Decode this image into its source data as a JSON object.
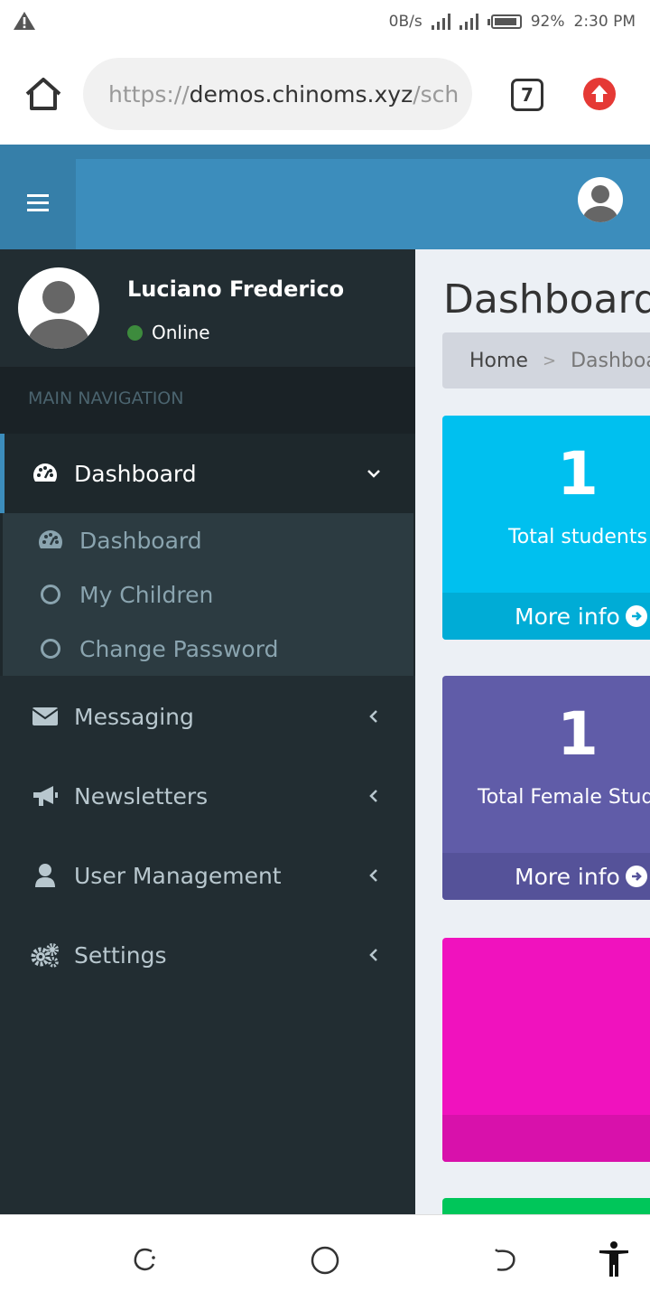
{
  "status_bar": {
    "net_speed": "0B/s",
    "battery": "92%",
    "time": "2:30 PM",
    "battery_level": 0.92
  },
  "browser": {
    "url_scheme": "https://",
    "url_host": "demos.chinoms.xyz",
    "url_path": "/sch",
    "tab_count": "7"
  },
  "user": {
    "name": "Luciano Frederico",
    "status": "Online"
  },
  "sidebar": {
    "nav_header": "MAIN NAVIGATION",
    "items": [
      {
        "label": "Dashboard",
        "icon": "dashboard-icon"
      },
      {
        "label": "Messaging",
        "icon": "envelope-icon"
      },
      {
        "label": "Newsletters",
        "icon": "bullhorn-icon"
      },
      {
        "label": "User Management",
        "icon": "user-icon"
      },
      {
        "label": "Settings",
        "icon": "gears-icon"
      }
    ],
    "submenu": [
      {
        "label": "Dashboard",
        "icon": "dashboard-icon"
      },
      {
        "label": "My Children",
        "icon": "circle-o-icon"
      },
      {
        "label": "Change Password",
        "icon": "circle-o-icon"
      }
    ]
  },
  "content": {
    "title": "Dashboard",
    "breadcrumb": {
      "home": "Home",
      "current": "Dashboard"
    },
    "boxes": [
      {
        "number": "1",
        "label": "Total students",
        "footer": "More info",
        "color": "#00c0ef",
        "footer_color": "#00acd6"
      },
      {
        "number": "1",
        "label": "Total Female Students",
        "footer": "More info",
        "color": "#605ca8",
        "footer_color": "#555299"
      },
      {
        "color": "#f012be",
        "footer_color": "#d811ab"
      },
      {
        "color": "#00c65a"
      }
    ]
  },
  "colors": {
    "header": "#3c8dbc",
    "sidebar": "#222d32"
  }
}
